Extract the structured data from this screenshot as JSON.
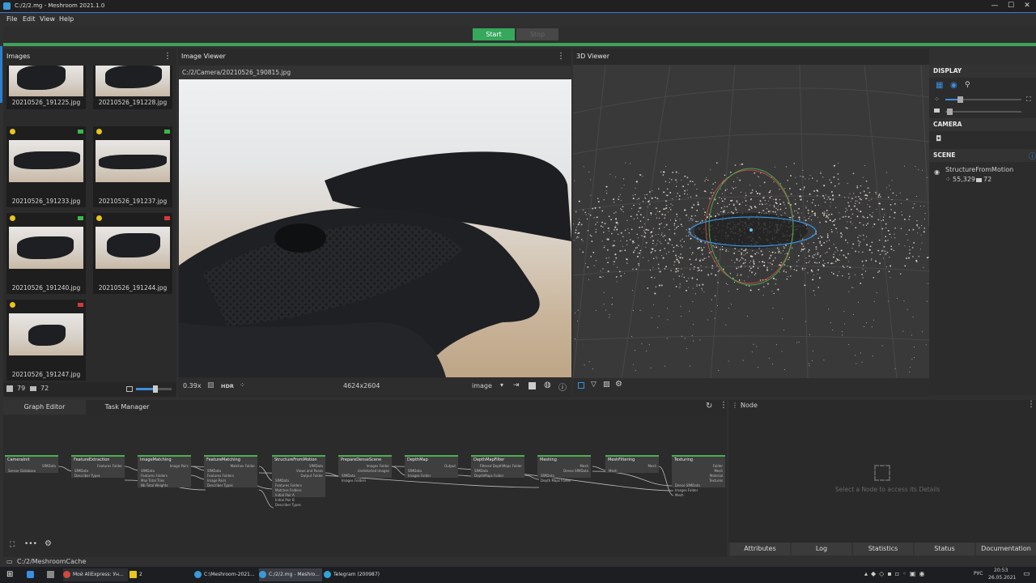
{
  "window": {
    "title": "C:/2/2.mg - Meshroom 2021.1.0",
    "min": "—",
    "max": "☐",
    "close": "✕"
  },
  "menu": [
    "File",
    "Edit",
    "View",
    "Help"
  ],
  "toolbar": {
    "start": "Start",
    "stop": "Stop"
  },
  "images_panel": {
    "title": "Images",
    "thumbs": [
      {
        "label": "20210526_191225.jpg"
      },
      {
        "label": "20210526_191228.jpg"
      },
      {
        "label": "20210526_191233.jpg"
      },
      {
        "label": "20210526_191237.jpg"
      },
      {
        "label": "20210526_191240.jpg"
      },
      {
        "label": "20210526_191244.jpg"
      },
      {
        "label": "20210526_191247.jpg"
      }
    ],
    "image_count": "79",
    "camera_count": "72"
  },
  "viewer": {
    "title": "Image Viewer",
    "path": "C:/2/Camera/20210526_190815.jpg",
    "zoom": "0.39x",
    "hdr": "HDR",
    "resolution": "4624x2604",
    "mode": "image"
  },
  "viewer3d": {
    "title": "3D Viewer",
    "display": "DISPLAY",
    "camera": "CAMERA",
    "scene": "SCENE",
    "scene_item": "StructureFromMotion",
    "points": "55,329",
    "cameras": "72"
  },
  "graph": {
    "tabs": [
      "Graph Editor",
      "Task Manager"
    ],
    "nodes": [
      {
        "name": "CameraInit",
        "inputs": [
          "Sensor Database"
        ],
        "outputs": [
          "SfMData"
        ]
      },
      {
        "name": "FeatureExtraction",
        "inputs": [
          "SfMData",
          "Describer Types"
        ],
        "outputs": [
          "Features Folder"
        ]
      },
      {
        "name": "ImageMatching",
        "inputs": [
          "SfMData",
          "Features Folders",
          "Max Total Tries",
          "Nb Total Weights"
        ],
        "outputs": [
          "Image Pairs"
        ]
      },
      {
        "name": "FeatureMatching",
        "inputs": [
          "SfMData",
          "Features Folders",
          "Image Pairs",
          "Describer Types"
        ],
        "outputs": [
          "Matches Folder"
        ]
      },
      {
        "name": "StructureFromMotion",
        "inputs": [
          "SfMData",
          "Features Folders",
          "Matches Folders",
          "Initial Pair A",
          "Initial Pair B",
          "Describer Types"
        ],
        "outputs": [
          "SfMData",
          "Views and Poses",
          "Output Folder"
        ]
      },
      {
        "name": "PrepareDenseScene",
        "inputs": [
          "SfMData",
          "Images Folders"
        ],
        "outputs": [
          "Images Folder",
          "Undistorted Images"
        ]
      },
      {
        "name": "DepthMap",
        "inputs": [
          "SfMData",
          "Images Folder"
        ],
        "outputs": [
          "Output"
        ]
      },
      {
        "name": "DepthMapFilter",
        "inputs": [
          "SfMData",
          "DepthMaps Folder"
        ],
        "outputs": [
          "Filtered DepthMaps Folder"
        ]
      },
      {
        "name": "Meshing",
        "inputs": [
          "SfMData",
          "Depth Maps Folder"
        ],
        "outputs": [
          "Mesh",
          "Dense SfMData"
        ]
      },
      {
        "name": "MeshFiltering",
        "inputs": [
          "Mesh"
        ],
        "outputs": [
          "Mesh"
        ]
      },
      {
        "name": "Texturing",
        "inputs": [
          "Dense SfMData",
          "Images Folder",
          "Mesh"
        ],
        "outputs": [
          "Folder",
          "Mesh",
          "Material",
          "Textures"
        ]
      }
    ]
  },
  "node_panel": {
    "title": "Node",
    "placeholder": "Select a Node to access its Details",
    "tabs": [
      "Attributes",
      "Log",
      "Statistics",
      "Status",
      "Documentation"
    ]
  },
  "statusbar": {
    "path": "C:/2/MeshroomCache"
  },
  "taskbar": {
    "items": [
      "Мой AliExpress: Ун...",
      "2",
      "C:\\Meshroom-2021...",
      "C:/2/2.mg - Meshro...",
      "Telegram (200987)"
    ],
    "lang": "РУС",
    "time": "20:53",
    "date": "26.05.2021"
  },
  "colors": {
    "accent": "#3fa35b",
    "start": "#36a85c",
    "node_header": "#4caf50"
  }
}
